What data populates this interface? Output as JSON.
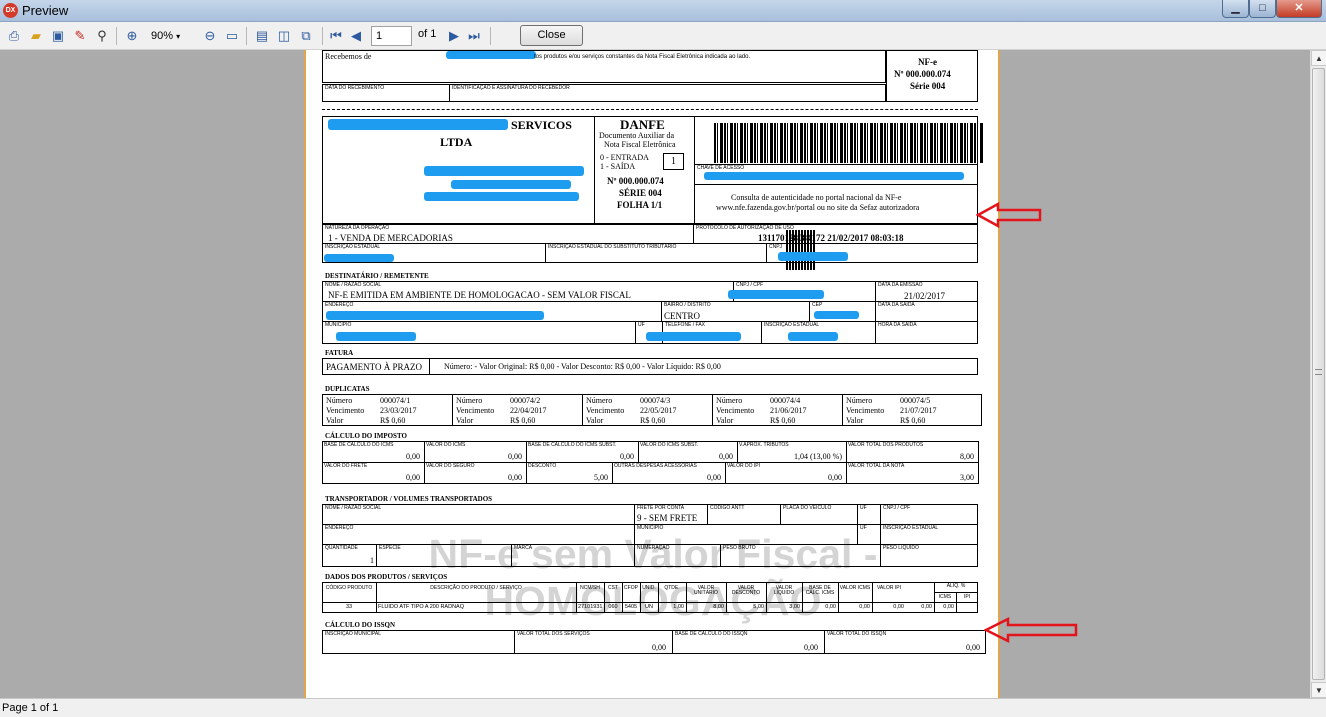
{
  "window": {
    "title": "Preview",
    "app_icon": "DX"
  },
  "toolbar": {
    "zoom": "90%",
    "page": "1",
    "of": "of 1",
    "close_label": "Close"
  },
  "status": {
    "page": "Page 1 of 1"
  },
  "receipt": {
    "text_pre": "Recebemos de",
    "text_post": "tos produtos e/ou serviços constantes da Nota Fiscal Eletrônica indicada ao lado.",
    "date_label": "DATA DO RECEBIMENTO",
    "id_label": "IDENTIFICAÇÃO E ASSINATURA DO RECEBEDOR",
    "nfe": "NF-e",
    "number": "Nº 000.000.074",
    "serie": "Série 004"
  },
  "emitter": {
    "name_line1": "SERVICOS",
    "name_line2": "LTDA"
  },
  "danfe": {
    "title": "DANFE",
    "sub1": "Documento Auxiliar da",
    "sub2": "Nota Fiscal Eletrônica",
    "entrada": "0 - ENTRADA",
    "saida": "1 - SAÍDA",
    "tipo": "1",
    "number": "Nº 000.000.074",
    "serie": "SÉRIE 004",
    "folha": "FOLHA 1/1"
  },
  "chave": {
    "label": "CHAVE DE ACESSO",
    "consulta1": "Consulta de autenticidade no portal nacional da NF-e",
    "consulta2": "www.nfe.fazenda.gov.br/portal ou no site da Sefaz autorizadora"
  },
  "natureza": {
    "label": "NATUREZA DA OPERAÇÃO",
    "value": "1 - VENDA DE MERCADORIAS",
    "prot_label": "PROTOCOLO DE AUTORIZAÇÃO DE USO",
    "prot_value": "131170128084172 21/02/2017 08:03:18",
    "ie_label": "INSCRIÇÃO ESTADUAL",
    "iest_label": "INSCRIÇÃO ESTADUAL DO SUBSTITUTO TRIBUTÁRIO",
    "cnpj_label": "CNPJ"
  },
  "dest": {
    "title": "DESTINATÁRIO / REMETENTE",
    "nome_label": "NOME / RAZÃO SOCIAL",
    "nome": "NF-E EMITIDA EM AMBIENTE DE HOMOLOGACAO - SEM VALOR FISCAL",
    "cnpj_label": "CNPJ / CPF",
    "emissao_label": "DATA DA EMISSÃO",
    "emissao": "21/02/2017",
    "end_label": "ENDEREÇO",
    "bairro_label": "BAIRRO / DISTRITO",
    "bairro": "CENTRO",
    "cep_label": "CEP",
    "saida_label": "DATA DA SAÍDA",
    "mun_label": "MUNICÍPIO",
    "uf_label": "UF",
    "fone_label": "TELEFONE / FAX",
    "ie_label": "INSCRIÇÃO ESTADUAL",
    "hora_label": "HORA DA SAÍDA"
  },
  "fatura": {
    "title": "FATURA",
    "text": "PAGAMENTO À PRAZO",
    "detail": "Número:    -  Valor Original: R$ 0,00  -  Valor Desconto: R$ 0,00  -  Valor Líquido: R$ 0,00"
  },
  "duplicatas": {
    "title": "DUPLICATAS",
    "lbl_num": "Número",
    "lbl_venc": "Vencimento",
    "lbl_valor": "Valor",
    "items": [
      {
        "numero": "000074/1",
        "venc": "23/03/2017",
        "valor": "R$ 0,60"
      },
      {
        "numero": "000074/2",
        "venc": "22/04/2017",
        "valor": "R$ 0,60"
      },
      {
        "numero": "000074/3",
        "venc": "22/05/2017",
        "valor": "R$ 0,60"
      },
      {
        "numero": "000074/4",
        "venc": "21/06/2017",
        "valor": "R$ 0,60"
      },
      {
        "numero": "000074/5",
        "venc": "21/07/2017",
        "valor": "R$ 0,60"
      }
    ]
  },
  "imposto": {
    "title": "CÁLCULO DO IMPOSTO",
    "row1": [
      {
        "label": "BASE DE CÁLCULO DO ICMS",
        "value": "0,00"
      },
      {
        "label": "VALOR DO ICMS",
        "value": "0,00"
      },
      {
        "label": "BASE DE CÁLCULO DO ICMS SUBST.",
        "value": "0,00"
      },
      {
        "label": "VALOR DO ICMS SUBST.",
        "value": "0,00"
      },
      {
        "label": "V.APROX. TRIBUTOS",
        "value": "1,04 (13,00 %)"
      },
      {
        "label": "VALOR TOTAL DOS PRODUTOS",
        "value": "8,00"
      }
    ],
    "row2": [
      {
        "label": "VALOR DO FRETE",
        "value": "0,00"
      },
      {
        "label": "VALOR DO SEGURO",
        "value": "0,00"
      },
      {
        "label": "DESCONTO",
        "value": "5,00"
      },
      {
        "label": "OUTRAS DESPESAS ACESSÓRIAS",
        "value": "0,00"
      },
      {
        "label": "VALOR DO IPI",
        "value": "0,00"
      },
      {
        "label": "VALOR TOTAL DA NOTA",
        "value": "3,00"
      }
    ]
  },
  "transp": {
    "title": "TRANSPORTADOR / VOLUMES TRANSPORTADOS",
    "nome_label": "NOME / RAZÃO SOCIAL",
    "frete_label": "FRETE POR CONTA",
    "frete": "9 - SEM FRETE",
    "antt_label": "CÓDIGO ANTT",
    "placa_label": "PLACA DO VEÍCULO",
    "uf_label": "UF",
    "cnpj_label": "CNPJ / CPF",
    "end_label": "ENDEREÇO",
    "mun_label": "MUNICÍPIO",
    "uf2_label": "UF",
    "ie_label": "INSCRIÇÃO ESTADUAL",
    "qtd_label": "QUANTIDADE",
    "qtd": "1",
    "esp_label": "ESPÉCIE",
    "marca_label": "MARCA",
    "num_label": "NUMERAÇÃO",
    "pb_label": "PESO BRUTO",
    "pl_label": "PESO LÍQUIDO"
  },
  "produtos": {
    "title": "DADOS DOS PRODUTOS / SERVIÇOS",
    "headers": [
      "CÓDIGO PRODUTO",
      "DESCRIÇÃO DO PRODUTO / SERVIÇO",
      "NCM/SH",
      "CST",
      "CFOP",
      "UNID.",
      "QTDE.",
      "VALOR UNITÁRIO",
      "VALOR DESCONTO",
      "VALOR LÍQUIDO",
      "BASE DE CÁLC. ICMS",
      "VALOR ICMS",
      "VALOR IPI",
      "ALÍQ. %",
      "ICMS",
      "IPI"
    ],
    "row": [
      "33",
      "FLUIDO ATF TIPO A 200 RADNAQ",
      "27101931",
      "060",
      "5405",
      "UN",
      "1,00",
      "8,00",
      "5,00",
      "3,00",
      "0,00",
      "0,00",
      "0,00",
      "0,00",
      "0,00"
    ]
  },
  "issqn": {
    "title": "CÁLCULO DO ISSQN",
    "im_label": "INSCRIÇÃO MUNICIPAL",
    "vts_label": "VALOR TOTAL DOS SERVIÇOS",
    "vts": "0,00",
    "base_label": "BASE DE CÁLCULO DO ISSQN",
    "base": "0,00",
    "val_label": "VALOR TOTAL DO ISSQN",
    "val": "0,00"
  },
  "watermark": {
    "line1": "NF-e sem Valor Fiscal -",
    "line2": "HOMOLOGAÇÃO"
  },
  "colors": {
    "arrow": "#e3141b",
    "redaction": "#1e9cf0",
    "page_border": "#e3a54a"
  }
}
